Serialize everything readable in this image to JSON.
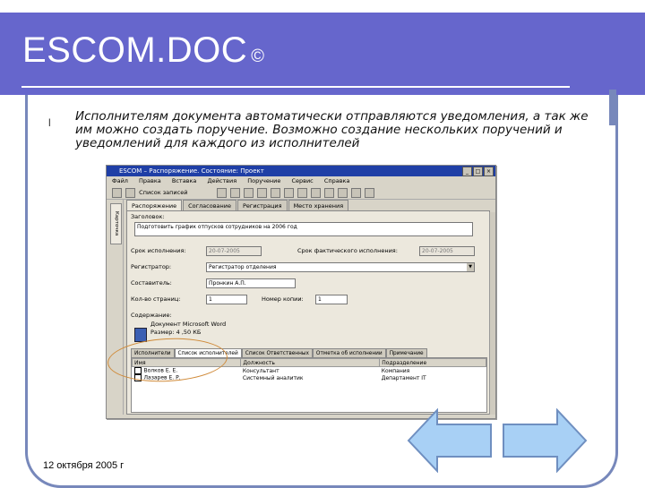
{
  "header": {
    "title": "ESCOM.DOC",
    "symbol": "©"
  },
  "bullet": {
    "glyph": "l",
    "text": "Исполнителям документа автоматически отправляются уведомления, а так же им можно создать поручение. Возможно создание нескольких поручений и уведомлений для каждого из исполнителей"
  },
  "app": {
    "window_title": "ESCOM – Распоряжение. Состояние: Проект",
    "menu": [
      "Файл",
      "Правка",
      "Вставка",
      "Действия",
      "Поручение",
      "Сервис",
      "Справка"
    ],
    "toolbar_label": "Список записей",
    "side_tab": "Карточка",
    "tabs": [
      "Распоряжение",
      "Согласование",
      "Регистрация",
      "Место хранения"
    ],
    "fields": {
      "title_label": "Заголовок:",
      "title_value": "Подготовить график отпусков сотрудников на 2006 год",
      "due_label": "Срок исполнения:",
      "due_value": "20-07-2005",
      "actual_label": "Срок фактического исполнения:",
      "actual_value": "20-07-2005",
      "registrar_label": "Регистратор:",
      "registrar_value": "Регистратор отделения",
      "author_label": "Составитель:",
      "author_value": "Пронкин А.П.",
      "pages_label": "Кол-во страниц:",
      "pages_value": "1",
      "copies_label": "Номер копии:",
      "copies_value": "1",
      "contents_label": "Содержание:",
      "doc_name": "Документ Microsoft Word",
      "doc_size": "Размер: 4 ,50 КБ"
    },
    "subtabs": [
      "Исполнители",
      "Список исполнителей",
      "Список Ответственных",
      "Отметка об исполнении",
      "Примечание"
    ],
    "grid": {
      "headers": [
        "Имя",
        "Должность",
        "Подразделение"
      ],
      "rows": [
        [
          "Волков Е. Е.",
          "Консультант",
          "Компания"
        ],
        [
          "Лазарев Е. Р.",
          "Системный аналитик",
          "Департамент IT"
        ]
      ]
    }
  },
  "footer": {
    "date": "12 октября 2005 г"
  },
  "colors": {
    "header_band": "#6666cc",
    "frame": "#7788bb",
    "arrow_fill": "#a8d0f5",
    "annotation": "#d08b3a"
  },
  "icons": {
    "prev": "left-arrow-icon",
    "next": "right-arrow-icon"
  }
}
